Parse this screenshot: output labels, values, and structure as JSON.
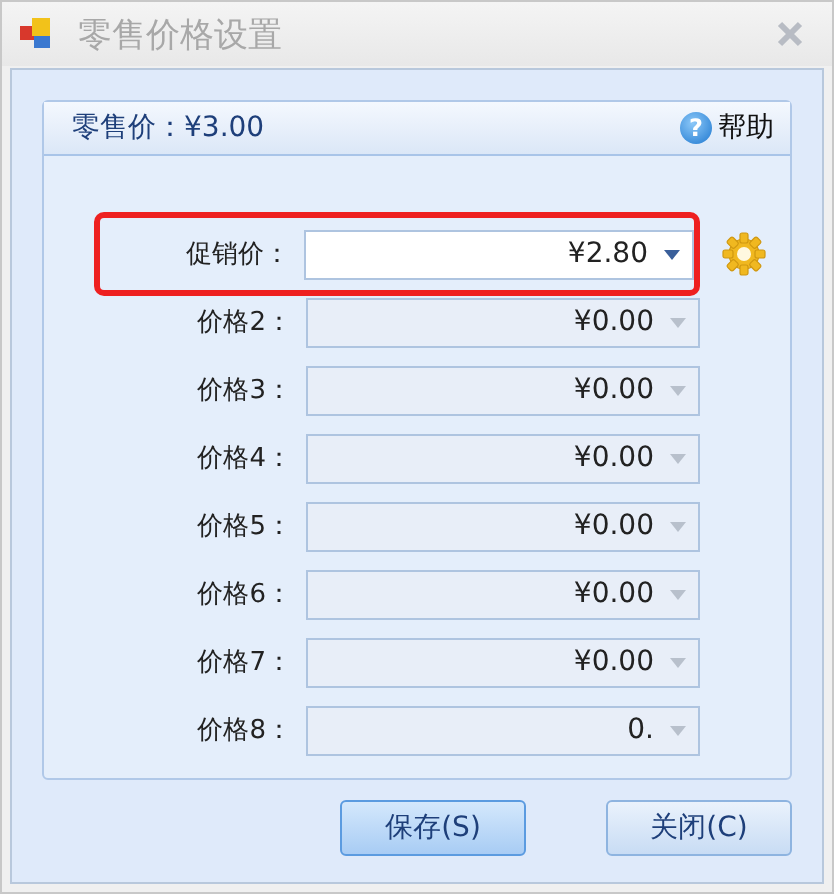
{
  "window": {
    "title": "零售价格设置"
  },
  "header": {
    "retail_price": "零售价：¥3.00",
    "help": {
      "icon": "?",
      "label": "帮助"
    }
  },
  "rows": [
    {
      "label": "促销价：",
      "value": "¥2.80",
      "disabled": false,
      "highlighted": true,
      "settings": true
    },
    {
      "label": "价格2：",
      "value": "¥0.00",
      "disabled": true
    },
    {
      "label": "价格3：",
      "value": "¥0.00",
      "disabled": true
    },
    {
      "label": "价格4：",
      "value": "¥0.00",
      "disabled": true
    },
    {
      "label": "价格5：",
      "value": "¥0.00",
      "disabled": true
    },
    {
      "label": "价格6：",
      "value": "¥0.00",
      "disabled": true
    },
    {
      "label": "价格7：",
      "value": "¥0.00",
      "disabled": true
    },
    {
      "label": "价格8：",
      "value": "0.",
      "disabled": true
    }
  ],
  "buttons": [
    {
      "label": "保存(S)",
      "focused": true
    },
    {
      "label": "关闭(C)",
      "focused": false
    }
  ]
}
